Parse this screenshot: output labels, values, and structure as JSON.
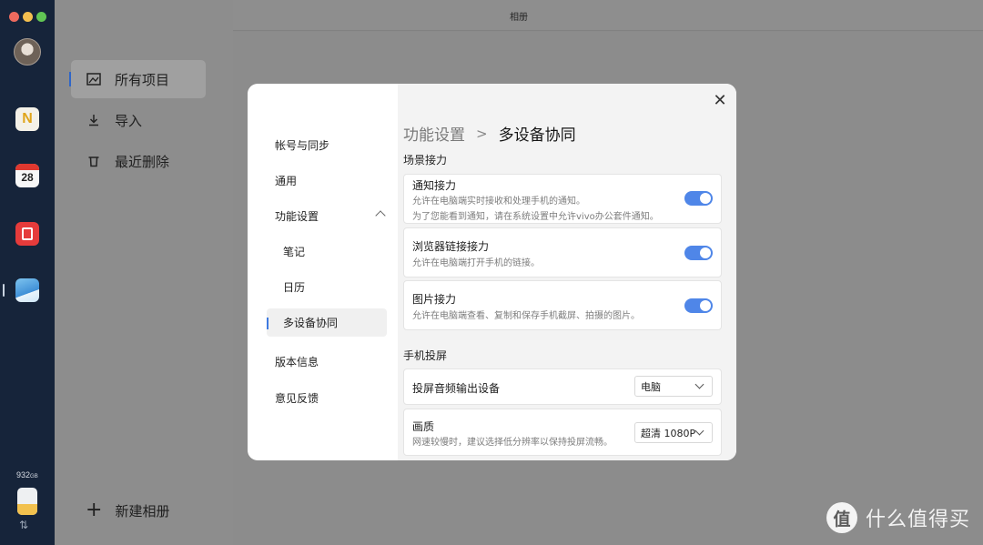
{
  "window": {
    "title": "相册"
  },
  "dock": {
    "calendar_day": "28",
    "notes_letter": "N",
    "storage": "932",
    "storage_unit": "GB"
  },
  "sidebar": {
    "items": [
      {
        "label": "所有项目",
        "icon": "image-icon"
      },
      {
        "label": "导入",
        "icon": "download-icon"
      },
      {
        "label": "最近删除",
        "icon": "trash-icon"
      }
    ],
    "new_album": "新建相册"
  },
  "modal": {
    "nav": [
      {
        "label": "帐号与同步"
      },
      {
        "label": "通用"
      },
      {
        "label": "功能设置",
        "expanded": true
      },
      {
        "label": "笔记"
      },
      {
        "label": "日历"
      },
      {
        "label": "多设备协同",
        "selected": true
      },
      {
        "label": "版本信息"
      },
      {
        "label": "意见反馈"
      }
    ],
    "breadcrumb": {
      "parent": "功能设置",
      "current": "多设备协同"
    },
    "section1": {
      "title": "场景接力",
      "cards": [
        {
          "title": "通知接力",
          "desc1": "允许在电脑端实时接收和处理手机的通知。",
          "desc2": "为了您能看到通知，请在系统设置中允许vivo办公套件通知。",
          "enabled": true
        },
        {
          "title": "浏览器链接接力",
          "desc1": "允许在电脑端打开手机的链接。",
          "enabled": true
        },
        {
          "title": "图片接力",
          "desc1": "允许在电脑端查看、复制和保存手机截屏、拍摄的图片。",
          "enabled": true
        }
      ]
    },
    "section2": {
      "title": "手机投屏",
      "audio": {
        "label": "投屏音频输出设备",
        "value": "电脑"
      },
      "quality": {
        "label": "画质",
        "desc": "网速较慢时，建议选择低分辨率以保持投屏流畅。",
        "value": "超清 1080P"
      }
    }
  },
  "watermark": {
    "badge": "值",
    "text": "什么值得买"
  },
  "colors": {
    "accent": "#4f86e8",
    "dock": "#16243a"
  }
}
